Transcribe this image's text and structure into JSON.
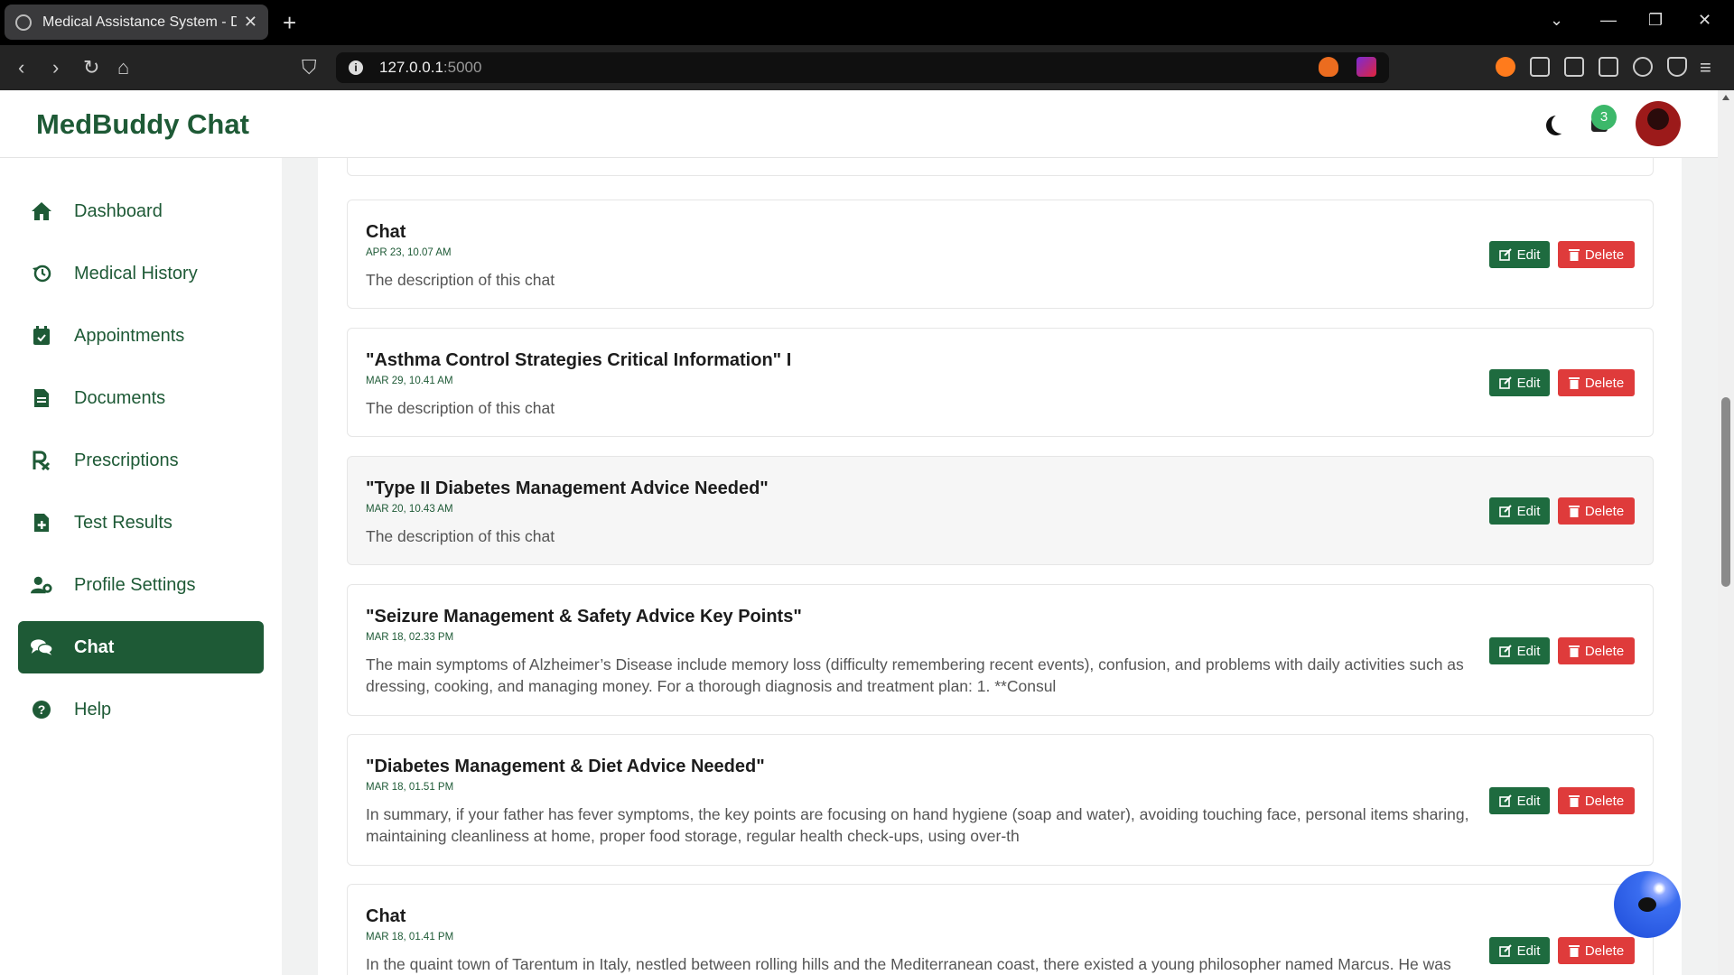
{
  "browser": {
    "tab_title": "Medical Assistance System - Da",
    "url_host": "127.0.0.1",
    "url_port": ":5000"
  },
  "app": {
    "brand": "MedBuddy Chat",
    "notification_count": "3"
  },
  "sidebar": {
    "items": [
      {
        "label": "Dashboard",
        "icon": "home-icon"
      },
      {
        "label": "Medical History",
        "icon": "history-icon"
      },
      {
        "label": "Appointments",
        "icon": "calendar-icon"
      },
      {
        "label": "Documents",
        "icon": "document-icon"
      },
      {
        "label": "Prescriptions",
        "icon": "prescription-icon"
      },
      {
        "label": "Test Results",
        "icon": "file-plus-icon"
      },
      {
        "label": "Profile Settings",
        "icon": "user-gear-icon"
      },
      {
        "label": "Chat",
        "icon": "chat-icon",
        "active": true
      },
      {
        "label": "Help",
        "icon": "help-icon"
      }
    ]
  },
  "buttons": {
    "edit": "Edit",
    "delete": "Delete"
  },
  "chats": [
    {
      "title": "Chat",
      "date": "APR 23, 10.07 AM",
      "description": "The description of this chat"
    },
    {
      "title": "\"Asthma Control Strategies Critical Information\" I",
      "date": "MAR 29, 10.41 AM",
      "description": "The description of this chat"
    },
    {
      "title": "\"Type II Diabetes Management Advice Needed\"",
      "date": "MAR 20, 10.43 AM",
      "description": "The description of this chat"
    },
    {
      "title": "\"Seizure Management & Safety Advice Key Points\"",
      "date": "MAR 18, 02.33 PM",
      "description": "The main symptoms of Alzheimer’s Disease include memory loss (difficulty remembering recent events), confusion, and problems with daily activities such as dressing, cooking, and managing money. For a thorough diagnosis and treatment plan: 1. **Consul"
    },
    {
      "title": "\"Diabetes Management & Diet Advice Needed\"",
      "date": "MAR 18, 01.51 PM",
      "description": "In summary, if your father has fever symptoms, the key points are focusing on hand hygiene (soap and water), avoiding touching face, personal items sharing, maintaining cleanliness at home, proper food storage, regular health check-ups, using over-th"
    },
    {
      "title": "Chat",
      "date": "MAR 18, 01.41 PM",
      "description": "In the quaint town of Tarentum in Italy, nestled between rolling hills and the Mediterranean coast, there existed a young philosopher named Marcus. He was"
    }
  ],
  "colors": {
    "brand_green": "#1e5a36",
    "delete_red": "#df3b3b",
    "badge_green": "#3cb86a"
  }
}
